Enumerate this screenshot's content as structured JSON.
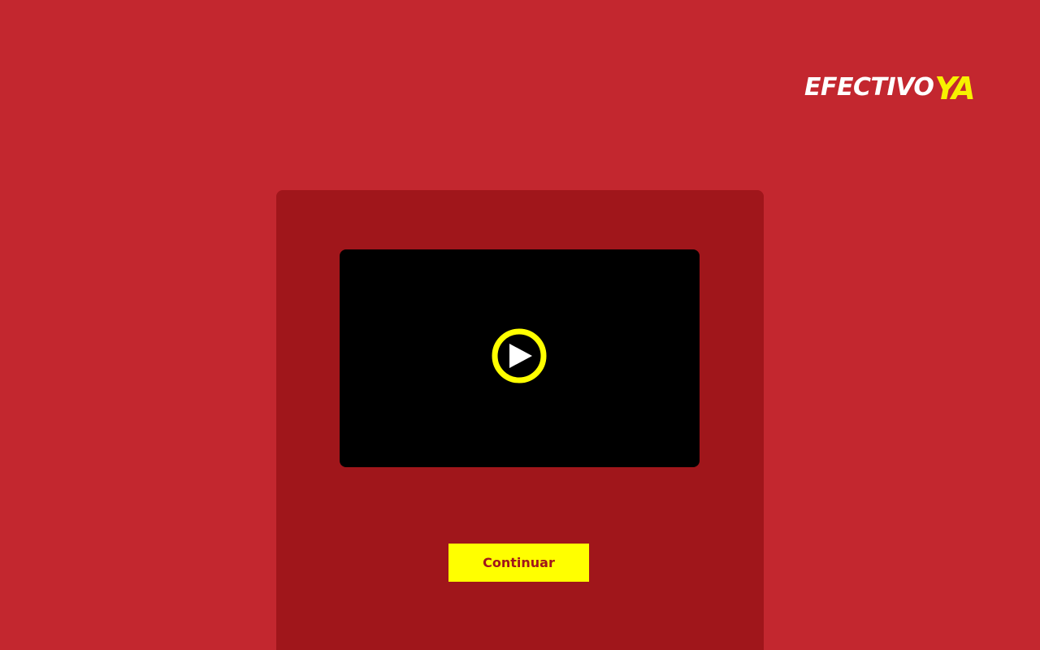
{
  "brand": {
    "logo_main": "EFECTIVO",
    "logo_accent": "YA",
    "colors": {
      "background": "#c3272f",
      "panel": "#a0161b",
      "accent": "#ffff00",
      "logo_white": "#ffffff"
    }
  },
  "video": {
    "play_icon": "play-icon"
  },
  "actions": {
    "continue_label": "Continuar"
  }
}
